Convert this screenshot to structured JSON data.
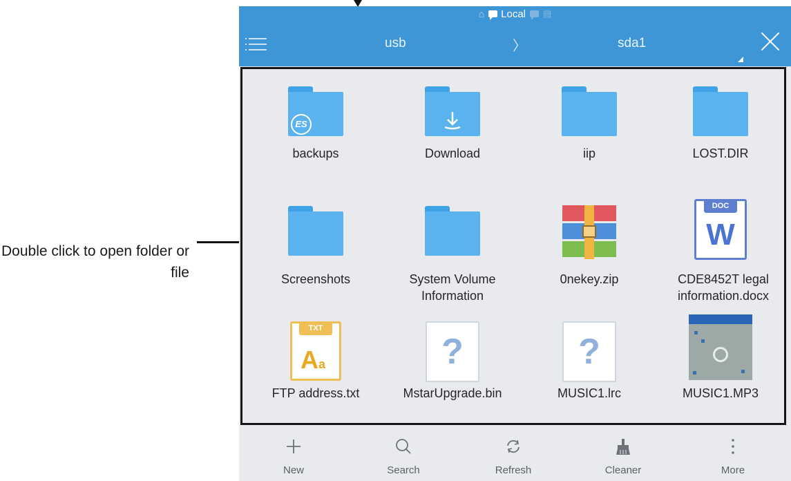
{
  "annotation": {
    "callout_text": "Double click to open folder or file"
  },
  "status_bar": {
    "home_icon": "home-icon",
    "location_label": "Local",
    "icons": [
      "chat-icon",
      "printer-icon"
    ]
  },
  "toolbar": {
    "menu_icon": "hamburger-menu-icon",
    "breadcrumb": [
      "usb",
      "sda1"
    ],
    "separator": "〉",
    "close_icon": "close-icon"
  },
  "files": [
    {
      "name": "backups",
      "type": "folder",
      "badge": "ES"
    },
    {
      "name": "Download",
      "type": "folder",
      "badge": "download-arrow-icon"
    },
    {
      "name": "iip",
      "type": "folder"
    },
    {
      "name": "LOST.DIR",
      "type": "folder"
    },
    {
      "name": "Screenshots",
      "type": "folder"
    },
    {
      "name": "System Volume Information",
      "type": "folder"
    },
    {
      "name": "0nekey.zip",
      "type": "zip"
    },
    {
      "name": "CDE8452T legal information.docx",
      "type": "doc",
      "tag": "DOC",
      "glyph": "W"
    },
    {
      "name": "FTP address.txt",
      "type": "txt",
      "tag": "TXT",
      "glyph": "A",
      "glyph_small": "a"
    },
    {
      "name": "MstarUpgrade.bin",
      "type": "unknown",
      "glyph": "?"
    },
    {
      "name": "MUSIC1.lrc",
      "type": "unknown",
      "glyph": "?"
    },
    {
      "name": "MUSIC1.MP3",
      "type": "audio-thumbnail"
    }
  ],
  "bottom_bar": [
    {
      "label": "New",
      "icon": "plus-icon"
    },
    {
      "label": "Search",
      "icon": "search-icon"
    },
    {
      "label": "Refresh",
      "icon": "refresh-icon"
    },
    {
      "label": "Cleaner",
      "icon": "broom-icon"
    },
    {
      "label": "More",
      "icon": "more-vertical-icon"
    }
  ],
  "colors": {
    "accent": "#3f96d6",
    "folder": "#5ab3ee",
    "background": "#e8eaee"
  }
}
